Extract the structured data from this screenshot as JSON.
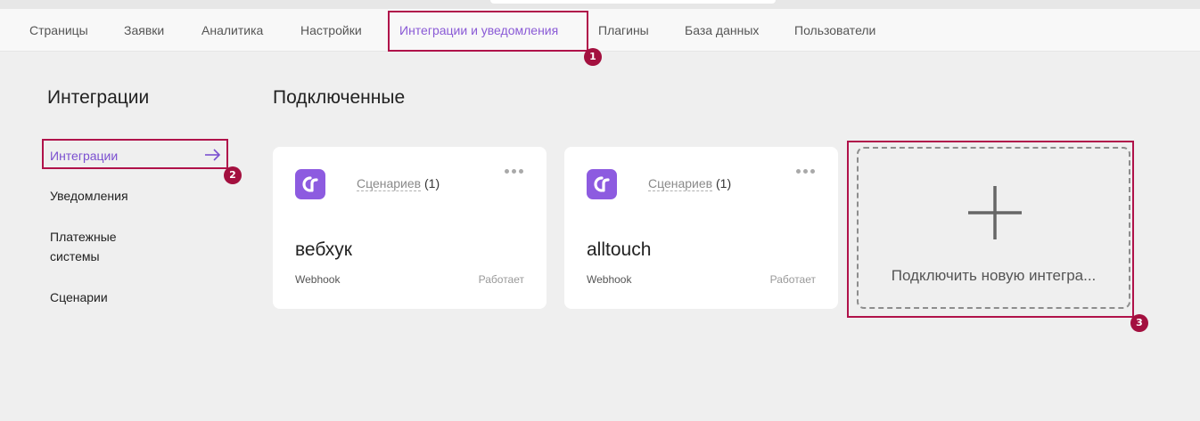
{
  "nav": {
    "items": [
      {
        "label": "Страницы",
        "active": false
      },
      {
        "label": "Заявки",
        "active": false
      },
      {
        "label": "Аналитика",
        "active": false
      },
      {
        "label": "Настройки",
        "active": false
      },
      {
        "label": "Интеграции и уведомления",
        "active": true
      },
      {
        "label": "Плагины",
        "active": false
      },
      {
        "label": "База данных",
        "active": false
      },
      {
        "label": "Пользователи",
        "active": false
      }
    ]
  },
  "sidebar": {
    "title": "Интеграции",
    "items": [
      {
        "label": "Интеграции",
        "active": true
      },
      {
        "label": "Уведомления",
        "active": false
      },
      {
        "label": "Платежные",
        "label_line2": "системы",
        "active": false
      },
      {
        "label": "Сценарии",
        "active": false
      }
    ]
  },
  "main": {
    "title": "Подключенные",
    "cards": [
      {
        "name": "вебхук",
        "type": "Webhook",
        "status": "Работает",
        "scenarios_label": "Сценариев",
        "scenarios_count": "(1)",
        "icon": "integration-logo-icon"
      },
      {
        "name": "alltouch",
        "type": "Webhook",
        "status": "Работает",
        "scenarios_label": "Сценариев",
        "scenarios_count": "(1)",
        "icon": "integration-logo-icon"
      }
    ],
    "add_card": {
      "label": "Подключить новую интегра...",
      "icon": "plus-icon"
    }
  },
  "annotations": [
    {
      "number": "1"
    },
    {
      "number": "2"
    },
    {
      "number": "3"
    }
  ],
  "colors": {
    "accent": "#8d5be0",
    "active_text": "#8a5ad6",
    "annotation": "#b0124a",
    "background": "#efefef"
  }
}
